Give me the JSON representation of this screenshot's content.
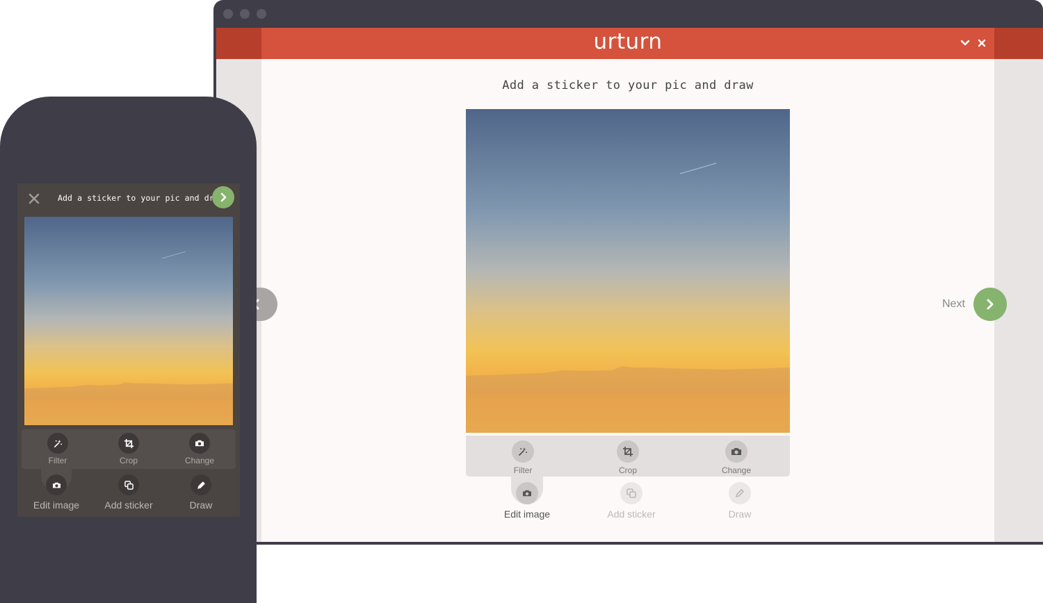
{
  "app": {
    "brand": "urturn"
  },
  "desktop": {
    "title": "Add a sticker to your pic and draw",
    "tools": [
      {
        "label": "Filter",
        "icon": "magic-wand-icon"
      },
      {
        "label": "Crop",
        "icon": "crop-icon"
      },
      {
        "label": "Change",
        "icon": "camera-icon"
      }
    ],
    "tabs": [
      {
        "label": "Edit image",
        "icon": "camera-icon",
        "active": true
      },
      {
        "label": "Add sticker",
        "icon": "sticker-icon",
        "active": false
      },
      {
        "label": "Draw",
        "icon": "pencil-icon",
        "active": false
      }
    ],
    "next_label": "Next"
  },
  "phone": {
    "title": "Add a sticker to your pic and draw",
    "tools": [
      {
        "label": "Filter",
        "icon": "magic-wand-icon"
      },
      {
        "label": "Crop",
        "icon": "crop-icon"
      },
      {
        "label": "Change",
        "icon": "camera-icon"
      }
    ],
    "tabs": [
      {
        "label": "Edit image",
        "icon": "camera-icon",
        "active": true
      },
      {
        "label": "Add sticker",
        "icon": "sticker-icon",
        "active": false
      },
      {
        "label": "Draw",
        "icon": "pencil-icon",
        "active": false
      }
    ]
  },
  "colors": {
    "brand_red": "#d5523c",
    "next_green": "#86b36d",
    "frame": "#3e3d48"
  }
}
